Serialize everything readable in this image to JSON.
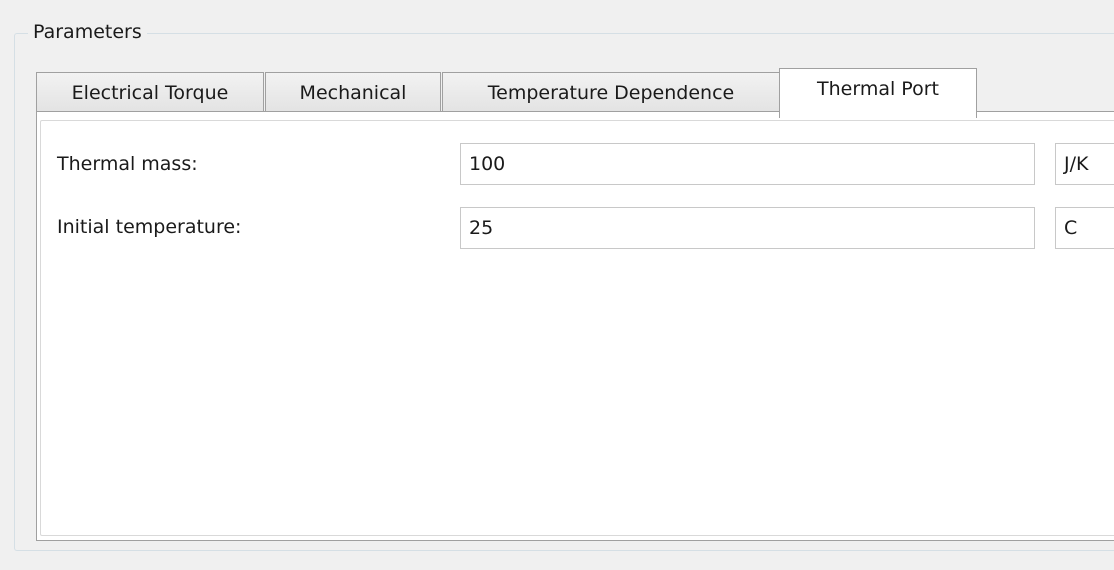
{
  "group": {
    "title": "Parameters"
  },
  "tabs": [
    {
      "label": "Electrical Torque",
      "active": false
    },
    {
      "label": "Mechanical",
      "active": false
    },
    {
      "label": "Temperature Dependence",
      "active": false
    },
    {
      "label": "Thermal Port",
      "active": true
    }
  ],
  "params": [
    {
      "label": "Thermal mass:",
      "value": "100",
      "unit": "J/K"
    },
    {
      "label": "Initial temperature:",
      "value": "25",
      "unit": "C"
    }
  ]
}
